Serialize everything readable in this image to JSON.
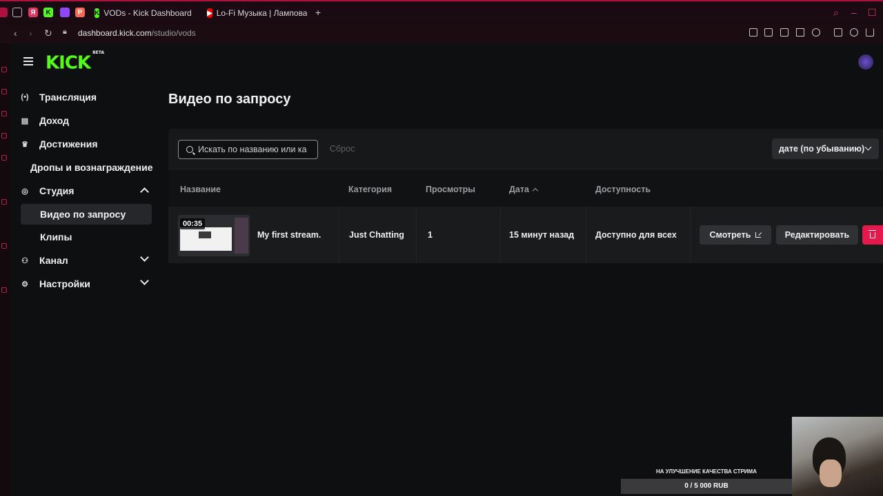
{
  "browser": {
    "tabs": [
      {
        "label": "VODs - Kick Dashboard",
        "icon": "kick-icon"
      },
      {
        "label": "Lo-Fi Музыка | Ламповая",
        "icon": "youtube-icon"
      }
    ],
    "url_domain": "dashboard.kick.com",
    "url_path": "/studio/vods"
  },
  "header": {
    "logo": "KICK",
    "logo_badge": "BETA"
  },
  "sidebar": {
    "items": [
      {
        "label": "Трансляция",
        "icon": "broadcast-icon"
      },
      {
        "label": "Доход",
        "icon": "income-icon"
      },
      {
        "label": "Достижения",
        "icon": "trophy-icon"
      },
      {
        "label": "Дропы и вознаграждение"
      },
      {
        "label": "Студия",
        "icon": "studio-icon",
        "expanded": true
      },
      {
        "label": "Видео по запросу",
        "active": true
      },
      {
        "label": "Клипы"
      },
      {
        "label": "Канал",
        "icon": "channel-icon",
        "expanded": false
      },
      {
        "label": "Настройки",
        "icon": "gear-icon",
        "expanded": false
      }
    ]
  },
  "main": {
    "title": "Видео по запросу",
    "search_placeholder": "Искать по названию или ка",
    "reset_label": "Сброс",
    "sort_label": "дате (по убыванию)",
    "columns": [
      "Название",
      "Категория",
      "Просмотры",
      "Дата",
      "Доступность"
    ],
    "rows": [
      {
        "duration": "00:35",
        "title": "My first stream.",
        "category": "Just Chatting",
        "views": "1",
        "date": "15 минут назад",
        "availability": "Доступно для всех",
        "watch_label": "Смотреть",
        "edit_label": "Редактировать"
      }
    ]
  },
  "overlay": {
    "donation_title": "НА УЛУЧШЕНИЕ КАЧЕСТВА СТРИМА",
    "donation_progress": "0 / 5 000 RUB"
  },
  "colors": {
    "brand": "#53fc18",
    "danger": "#e51a4c",
    "accent": "#b0103f"
  }
}
